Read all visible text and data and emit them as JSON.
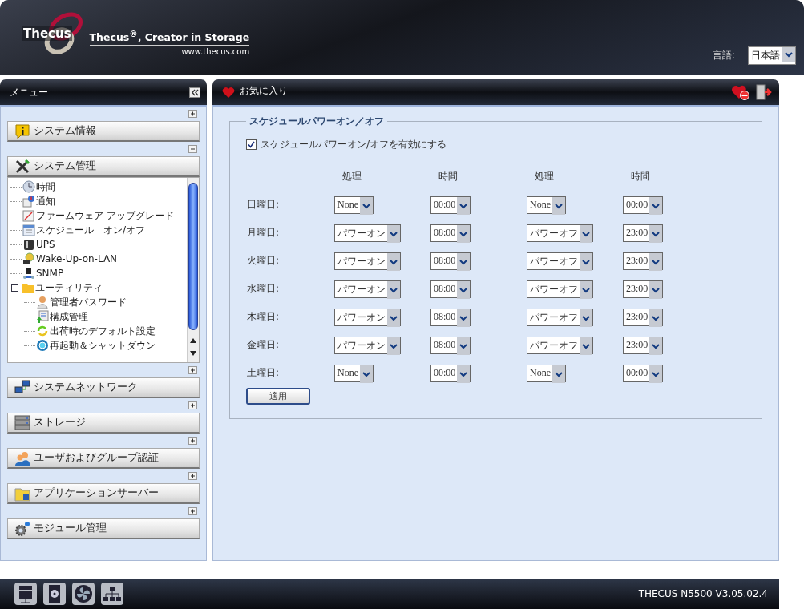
{
  "header": {
    "logo": "Thecus",
    "tagline": "Thecus$^{®}$, Creator in Storage",
    "url": "www.thecus.com",
    "language_label": "言語:",
    "language": "日本語"
  },
  "menu": {
    "title": "メニュー",
    "sections": [
      {
        "label": "システム情報",
        "expanded": false
      },
      {
        "label": "システム管理",
        "expanded": true,
        "items": [
          {
            "label": "時間"
          },
          {
            "label": "通知"
          },
          {
            "label": "ファームウェア アップグレード"
          },
          {
            "label": "スケジュール　オン/オフ"
          },
          {
            "label": "UPS"
          },
          {
            "label": "Wake-Up-on-LAN"
          },
          {
            "label": "SNMP"
          },
          {
            "label": "ユーティリティ",
            "expanded": true,
            "children": [
              {
                "label": "管理者パスワード"
              },
              {
                "label": "構成管理"
              },
              {
                "label": "出荷時のデフォルト設定"
              },
              {
                "label": "再起動＆シャットダウン"
              }
            ]
          }
        ]
      },
      {
        "label": "システムネットワーク",
        "expanded": false
      },
      {
        "label": "ストレージ",
        "expanded": false
      },
      {
        "label": "ユーザおよびグループ認証",
        "expanded": false
      },
      {
        "label": "アプリケーションサーバー",
        "expanded": false
      },
      {
        "label": "モジュール管理",
        "expanded": false
      }
    ]
  },
  "favorites": {
    "title": "お気に入り"
  },
  "schedule": {
    "title": "スケジュールパワーオン／オフ",
    "enable": {
      "label": "スケジュールパワーオン/オフを有効にする",
      "checked": true
    },
    "columns": [
      "処理",
      "時間",
      "処理",
      "時間"
    ],
    "rows": [
      {
        "day": "日曜日:",
        "cells": [
          "None",
          "00:00",
          "None",
          "00:00"
        ]
      },
      {
        "day": "月曜日:",
        "cells": [
          "パワーオン",
          "08:00",
          "パワーオフ",
          "23:00"
        ]
      },
      {
        "day": "火曜日:",
        "cells": [
          "パワーオン",
          "08:00",
          "パワーオフ",
          "23:00"
        ]
      },
      {
        "day": "水曜日:",
        "cells": [
          "パワーオン",
          "08:00",
          "パワーオフ",
          "23:00"
        ]
      },
      {
        "day": "木曜日:",
        "cells": [
          "パワーオン",
          "08:00",
          "パワーオフ",
          "23:00"
        ]
      },
      {
        "day": "金曜日:",
        "cells": [
          "パワーオン",
          "08:00",
          "パワーオフ",
          "23:00"
        ]
      },
      {
        "day": "土曜日:",
        "cells": [
          "None",
          "00:00",
          "None",
          "00:00"
        ]
      }
    ],
    "apply": "適用"
  },
  "footer": {
    "version": "THECUS N5500 V3.05.02.4"
  }
}
